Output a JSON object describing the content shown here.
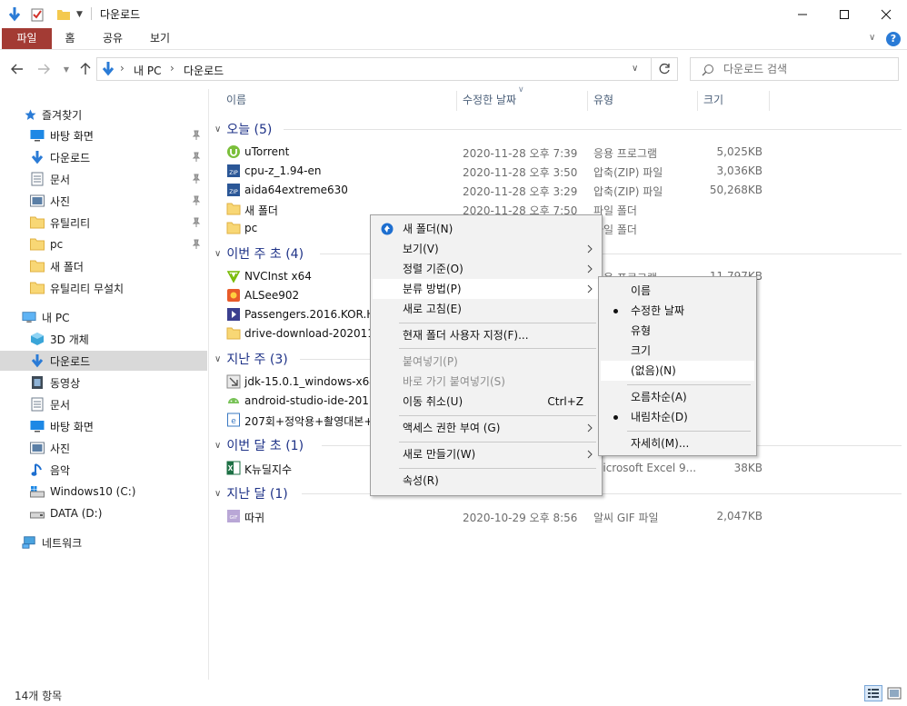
{
  "window": {
    "title": "다운로드",
    "min_label": "─",
    "max_label": "☐",
    "close_label": "✕"
  },
  "ribbon": {
    "tabs": [
      "파일",
      "홈",
      "공유",
      "보기"
    ]
  },
  "address": {
    "crumbs": [
      "내 PC",
      "다운로드"
    ]
  },
  "search": {
    "placeholder": "다운로드 검색"
  },
  "nav": {
    "quick_access": "즐겨찾기",
    "quick_items": [
      "바탕 화면",
      "다운로드",
      "문서",
      "사진",
      "유틸리티",
      "pc",
      "새 폴더",
      "유틸리티 무설치"
    ],
    "this_pc": "내 PC",
    "pc_items": [
      "3D 개체",
      "다운로드",
      "동영상",
      "문서",
      "바탕 화면",
      "사진",
      "음악",
      "Windows10 (C:)",
      "DATA (D:)"
    ],
    "network": "네트워크"
  },
  "columns": {
    "name": "이름",
    "date": "수정한 날짜",
    "type": "유형",
    "size": "크기"
  },
  "groups": [
    {
      "label": "오늘 (5)"
    },
    {
      "label": "이번 주 초 (4)"
    },
    {
      "label": "지난 주 (3)"
    },
    {
      "label": "이번 달 초 (1)"
    },
    {
      "label": "지난 달 (1)"
    }
  ],
  "files": [
    {
      "name": "uTorrent",
      "date": "2020-11-28 오후 7:39",
      "type": "응용 프로그램",
      "size": "5,025KB",
      "icon": "utorrent-icon"
    },
    {
      "name": "cpu-z_1.94-en",
      "date": "2020-11-28 오후 3:50",
      "type": "압축(ZIP) 파일",
      "size": "3,036KB",
      "icon": "zip-icon"
    },
    {
      "name": "aida64extreme630",
      "date": "2020-11-28 오후 3:29",
      "type": "압축(ZIP) 파일",
      "size": "50,268KB",
      "icon": "zip-icon"
    },
    {
      "name": "새 폴더",
      "date": "2020-11-28 오후 7:50",
      "type": "파일 폴더",
      "size": "",
      "icon": "folder-icon"
    },
    {
      "name": "pc",
      "date": "",
      "type": "파일 폴더",
      "size": "",
      "icon": "folder-icon"
    },
    {
      "name": "NVCInst x64",
      "date": "",
      "type": "응용 프로그램",
      "size": "11,797KB",
      "icon": "nvidia-icon"
    },
    {
      "name": "ALSee902",
      "date": "",
      "type": "",
      "size": "",
      "icon": "alsee-icon"
    },
    {
      "name": "Passengers.2016.KOR.HD",
      "date": "",
      "type": "",
      "size": "",
      "icon": "video-icon"
    },
    {
      "name": "drive-download-2020112",
      "date": "",
      "type": "",
      "size": "",
      "icon": "folder-icon"
    },
    {
      "name": "jdk-15.0.1_windows-x64_",
      "date": "",
      "type": "",
      "size": "",
      "icon": "installer-icon"
    },
    {
      "name": "android-studio-ide-201.6",
      "date": "",
      "type": "",
      "size": "",
      "icon": "android-icon"
    },
    {
      "name": "207회+정악용+촬영대본+",
      "date": "",
      "type": "",
      "size": "",
      "icon": "document-icon"
    },
    {
      "name": "K뉴딜지수",
      "date": "",
      "type": "Microsoft Excel 9...",
      "size": "38KB",
      "icon": "excel-icon"
    },
    {
      "name": "따귀",
      "date": "2020-10-29 오후 8:56",
      "type": "알씨 GIF 파일",
      "size": "2,047KB",
      "icon": "gif-icon"
    }
  ],
  "context_menu": {
    "items": [
      {
        "label": "새 폴더(N)"
      },
      {
        "label": "보기(V)"
      },
      {
        "label": "정렬 기준(O)"
      },
      {
        "label": "분류 방법(P)"
      },
      {
        "label": "새로 고침(E)"
      },
      {
        "label": "현재 폴더 사용자 지정(F)..."
      },
      {
        "label": "붙여넣기(P)"
      },
      {
        "label": "바로 가기 붙여넣기(S)"
      },
      {
        "label": "이동 취소(U)",
        "shortcut": "Ctrl+Z"
      },
      {
        "label": "액세스 권한 부여 (G)"
      },
      {
        "label": "새로 만들기(W)"
      },
      {
        "label": "속성(R)"
      }
    ]
  },
  "group_by_menu": {
    "items": [
      {
        "label": "이름"
      },
      {
        "label": "수정한 날짜"
      },
      {
        "label": "유형"
      },
      {
        "label": "크기"
      },
      {
        "label": "(없음)(N)"
      },
      {
        "label": "오름차순(A)"
      },
      {
        "label": "내림차순(D)"
      },
      {
        "label": "자세히(M)..."
      }
    ]
  },
  "status": {
    "item_count": "14개 항목"
  }
}
